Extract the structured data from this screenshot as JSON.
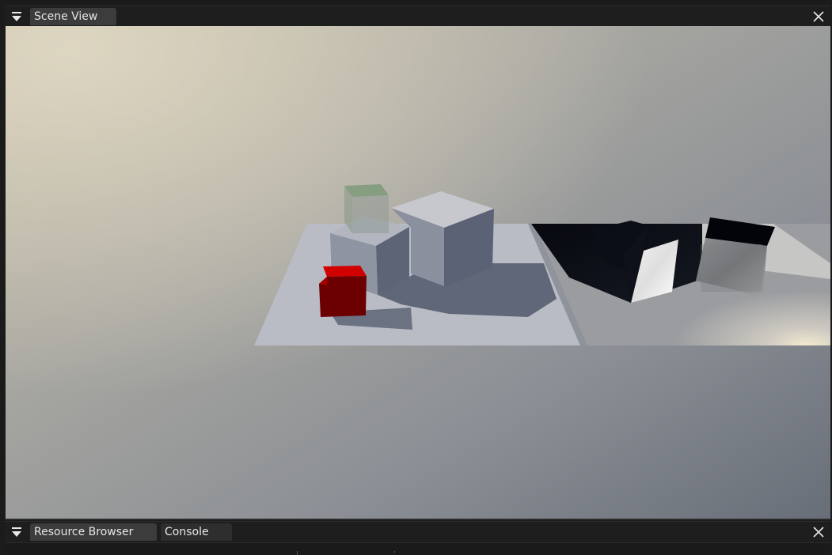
{
  "scene_panel": {
    "tab_label": "Scene View",
    "menu_icon": "dropdown-triangle-icon",
    "close_icon": "close-icon"
  },
  "bottom_panel": {
    "tabs": [
      {
        "label": "Resource Browser",
        "active": true
      },
      {
        "label": "Console",
        "active": false
      }
    ],
    "menu_icon": "dropdown-triangle-icon",
    "close_icon": "close-icon"
  },
  "colors": {
    "panel_bg": "#1e1e1e",
    "tab_active": "#3c3c3c",
    "tab_inactive": "#2e2e2e",
    "text": "#e6e6e6",
    "red_cube": "#b00000",
    "green_cube": "#6e8a6a"
  }
}
